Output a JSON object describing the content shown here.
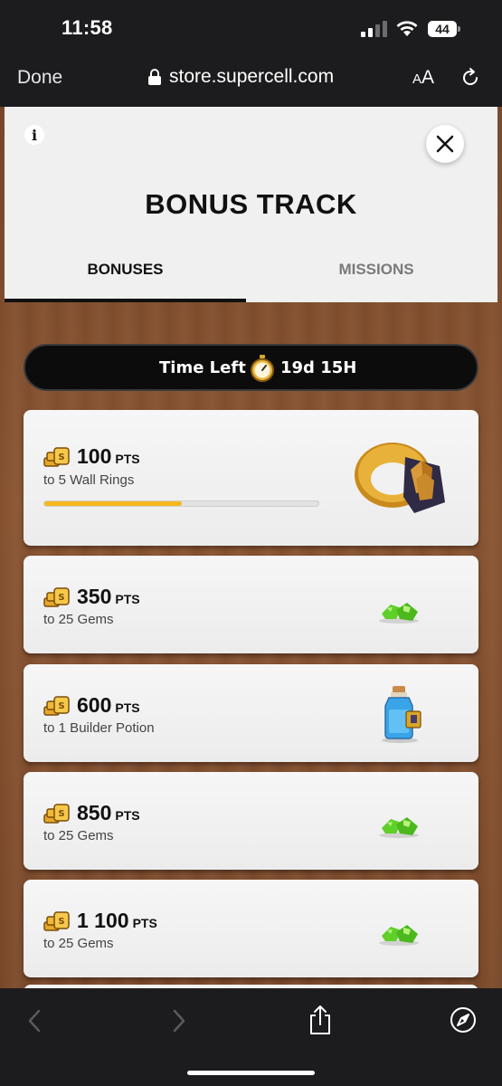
{
  "status_bar": {
    "time": "11:58",
    "battery_level": "44"
  },
  "browser": {
    "done_label": "Done",
    "url": "store.supercell.com",
    "text_size_label_small": "A",
    "text_size_label_large": "A"
  },
  "header": {
    "info_glyph": "i",
    "title": "BONUS TRACK",
    "tabs": [
      {
        "label": "BONUSES",
        "active": true
      },
      {
        "label": "MISSIONS",
        "active": false
      }
    ]
  },
  "timer": {
    "label": "Time Left",
    "value": "19d 15H"
  },
  "bonuses": [
    {
      "points": "100",
      "unit": "PTS",
      "reward": "to 5 Wall Rings",
      "progress_fraction": 0.5,
      "reward_icon": "wall-ring-icon"
    },
    {
      "points": "350",
      "unit": "PTS",
      "reward": "to 25 Gems",
      "reward_icon": "gems-icon"
    },
    {
      "points": "600",
      "unit": "PTS",
      "reward": "to 1 Builder Potion",
      "reward_icon": "builder-potion-icon"
    },
    {
      "points": "850",
      "unit": "PTS",
      "reward": "to 25 Gems",
      "reward_icon": "gems-icon"
    },
    {
      "points": "1 100",
      "unit": "PTS",
      "reward": "to 25 Gems",
      "reward_icon": "gems-icon"
    }
  ],
  "colors": {
    "progress_fill": "#f5b81c",
    "browser_chrome": "#1c1c1e",
    "panel": "#f0f0f0",
    "timer_bg": "#0c0c0c"
  }
}
